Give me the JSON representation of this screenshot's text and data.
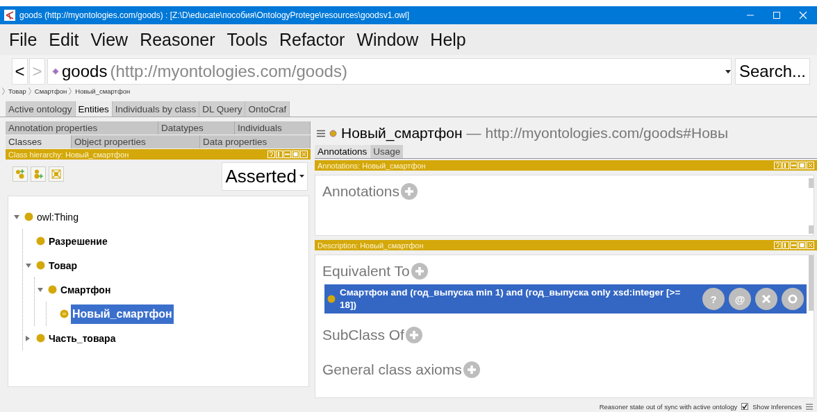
{
  "window": {
    "title": "goods (http://myontologies.com/goods) : [Z:\\D\\educate\\пособия\\OntologyProtege\\resources\\goodsv1.owl]"
  },
  "menu": [
    "File",
    "Edit",
    "View",
    "Reasoner",
    "Tools",
    "Refactor",
    "Window",
    "Help"
  ],
  "navigation": {
    "back": "<",
    "forward": ">",
    "forward_disabled": true,
    "ontology_name": "goods",
    "ontology_iri": "(http://myontologies.com/goods)",
    "search": "Search..."
  },
  "breadcrumb": [
    "Товар",
    "Смартфон",
    "Новый_смартфон"
  ],
  "tabs": [
    {
      "label": "Active ontology",
      "selected": false
    },
    {
      "label": "Entities",
      "selected": true
    },
    {
      "label": "Individuals by class",
      "selected": false
    },
    {
      "label": "DL Query",
      "selected": false
    },
    {
      "label": "OntoCraf",
      "selected": false
    }
  ],
  "entity_tabs": [
    [
      {
        "label": "Annotation properties",
        "selected": false
      },
      {
        "label": "Datatypes",
        "selected": false
      },
      {
        "label": "Individuals",
        "selected": false
      }
    ],
    [
      {
        "label": "Classes",
        "selected": true
      },
      {
        "label": "Object properties",
        "selected": false
      },
      {
        "label": "Data properties",
        "selected": false
      }
    ]
  ],
  "class_hierarchy": {
    "header": "Class hierarchy: Новый_смартфон",
    "mode": "Asserted",
    "tree": [
      {
        "label": "owl:Thing",
        "bold": false,
        "defined": false,
        "expandable": true,
        "expanded": true,
        "selected": false,
        "children": [
          {
            "label": "Разрешение",
            "bold": true,
            "defined": false,
            "expandable": false,
            "selected": false
          },
          {
            "label": "Товар",
            "bold": true,
            "defined": false,
            "expandable": true,
            "expanded": true,
            "selected": false,
            "children": [
              {
                "label": "Смартфон",
                "bold": true,
                "defined": false,
                "expandable": true,
                "expanded": true,
                "selected": false,
                "children": [
                  {
                    "label": "Новый_смартфон",
                    "bold": true,
                    "defined": true,
                    "expandable": false,
                    "selected": true
                  }
                ]
              }
            ]
          },
          {
            "label": "Часть_товара",
            "bold": true,
            "defined": false,
            "expandable": true,
            "expanded": false,
            "selected": false
          }
        ]
      }
    ]
  },
  "entity": {
    "name": "Новый_смартфон",
    "separator": "—",
    "iri": "http://myontologies.com/goods#Новы"
  },
  "entity_view_tabs": [
    {
      "label": "Annotations",
      "selected": true
    },
    {
      "label": "Usage",
      "selected": false
    }
  ],
  "annotations_view": {
    "header": "Annotations: Новый_смартфон",
    "sections": [
      {
        "title": "Annotations"
      }
    ]
  },
  "description_view": {
    "header": "Description: Новый_смартфон",
    "sections": [
      {
        "title": "Equivalent To",
        "items": [
          {
            "text": "Смартфон and (год_выпуска min 1) and (год_выпуска only xsd:integer [>= 18])",
            "selected": true,
            "buttons": [
              "?",
              "@"
            ]
          }
        ]
      },
      {
        "title": "SubClass Of"
      },
      {
        "title": "General class axioms"
      }
    ]
  },
  "status_bar": {
    "message": "Reasoner state out of sync with active ontology",
    "show_inferences": {
      "label": "Show Inferences",
      "checked": true
    }
  }
}
